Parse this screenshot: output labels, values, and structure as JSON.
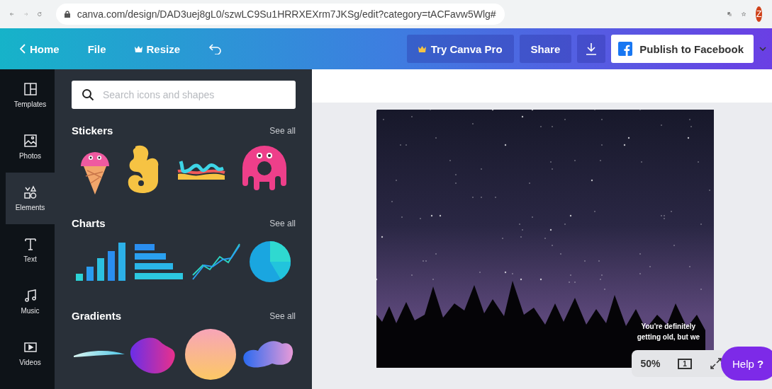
{
  "browser": {
    "url": "canva.com/design/DAD3uej8gL0/szwLC9Su1HRRXEXrm7JKSg/edit?category=tACFavw5Wlg#",
    "profile_initial": "Z"
  },
  "toolbar": {
    "left": [
      {
        "label": "Home",
        "kind": "back"
      },
      {
        "label": "File",
        "kind": "plain"
      },
      {
        "label": "Resize",
        "kind": "crown"
      }
    ],
    "try_pro": "Try Canva Pro",
    "share": "Share",
    "publish": "Publish to Facebook"
  },
  "rail": [
    {
      "label": "Templates",
      "kind": "templates",
      "selected": false
    },
    {
      "label": "Photos",
      "kind": "photos",
      "selected": false
    },
    {
      "label": "Elements",
      "kind": "elements",
      "selected": true
    },
    {
      "label": "Text",
      "kind": "text",
      "selected": false
    },
    {
      "label": "Music",
      "kind": "music",
      "selected": false
    },
    {
      "label": "Videos",
      "kind": "videos",
      "selected": false
    }
  ],
  "panel": {
    "search_placeholder": "Search icons and shapes",
    "sections": [
      {
        "title": "Stickers",
        "see_all": "See all",
        "kind": "stickers"
      },
      {
        "title": "Charts",
        "see_all": "See all",
        "kind": "charts"
      },
      {
        "title": "Gradients",
        "see_all": "See all",
        "kind": "gradients"
      }
    ]
  },
  "canvas": {
    "caption_lines": [
      "You're definitely",
      "getting old, but we"
    ]
  },
  "zoom": {
    "percent": "50%",
    "page_number": "1"
  },
  "help": {
    "label": "Help",
    "icon": "?"
  }
}
